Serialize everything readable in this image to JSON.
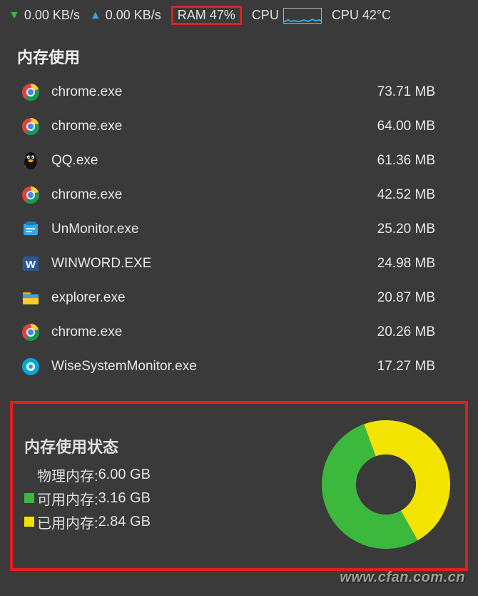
{
  "topbar": {
    "download_speed": "0.00 KB/s",
    "upload_speed": "0.00 KB/s",
    "ram_label": "RAM 47%",
    "cpu_label": "CPU",
    "cpu_temp": "CPU 42°C"
  },
  "memory_usage": {
    "title": "内存使用",
    "processes": [
      {
        "icon": "chrome",
        "name": "chrome.exe",
        "mem": "73.71 MB"
      },
      {
        "icon": "chrome",
        "name": "chrome.exe",
        "mem": "64.00 MB"
      },
      {
        "icon": "qq",
        "name": "QQ.exe",
        "mem": "61.36 MB"
      },
      {
        "icon": "chrome",
        "name": "chrome.exe",
        "mem": "42.52 MB"
      },
      {
        "icon": "unmonitor",
        "name": "UnMonitor.exe",
        "mem": "25.20 MB"
      },
      {
        "icon": "word",
        "name": "WINWORD.EXE",
        "mem": "24.98 MB"
      },
      {
        "icon": "explorer",
        "name": "explorer.exe",
        "mem": "20.87 MB"
      },
      {
        "icon": "chrome",
        "name": "chrome.exe",
        "mem": "20.26 MB"
      },
      {
        "icon": "wise",
        "name": "WiseSystemMonitor.exe",
        "mem": "17.27 MB"
      }
    ]
  },
  "memory_status": {
    "title": "内存使用状态",
    "physical_label": "物理内存:",
    "physical_value": "6.00 GB",
    "available_label": "可用内存:",
    "available_value": "3.16 GB",
    "used_label": "已用内存:",
    "used_value": "2.84 GB"
  },
  "chart_data": {
    "type": "pie",
    "title": "内存使用状态",
    "series": [
      {
        "name": "可用内存",
        "value": 3.16,
        "unit": "GB",
        "color": "#3cb83c"
      },
      {
        "name": "已用内存",
        "value": 2.84,
        "unit": "GB",
        "color": "#f2e400"
      }
    ],
    "total": 6.0
  },
  "watermark": "www.cfan.com.cn",
  "colors": {
    "highlight_border": "#e02020",
    "green": "#3cb83c",
    "yellow": "#f2e400",
    "blue": "#2fa8e8"
  }
}
